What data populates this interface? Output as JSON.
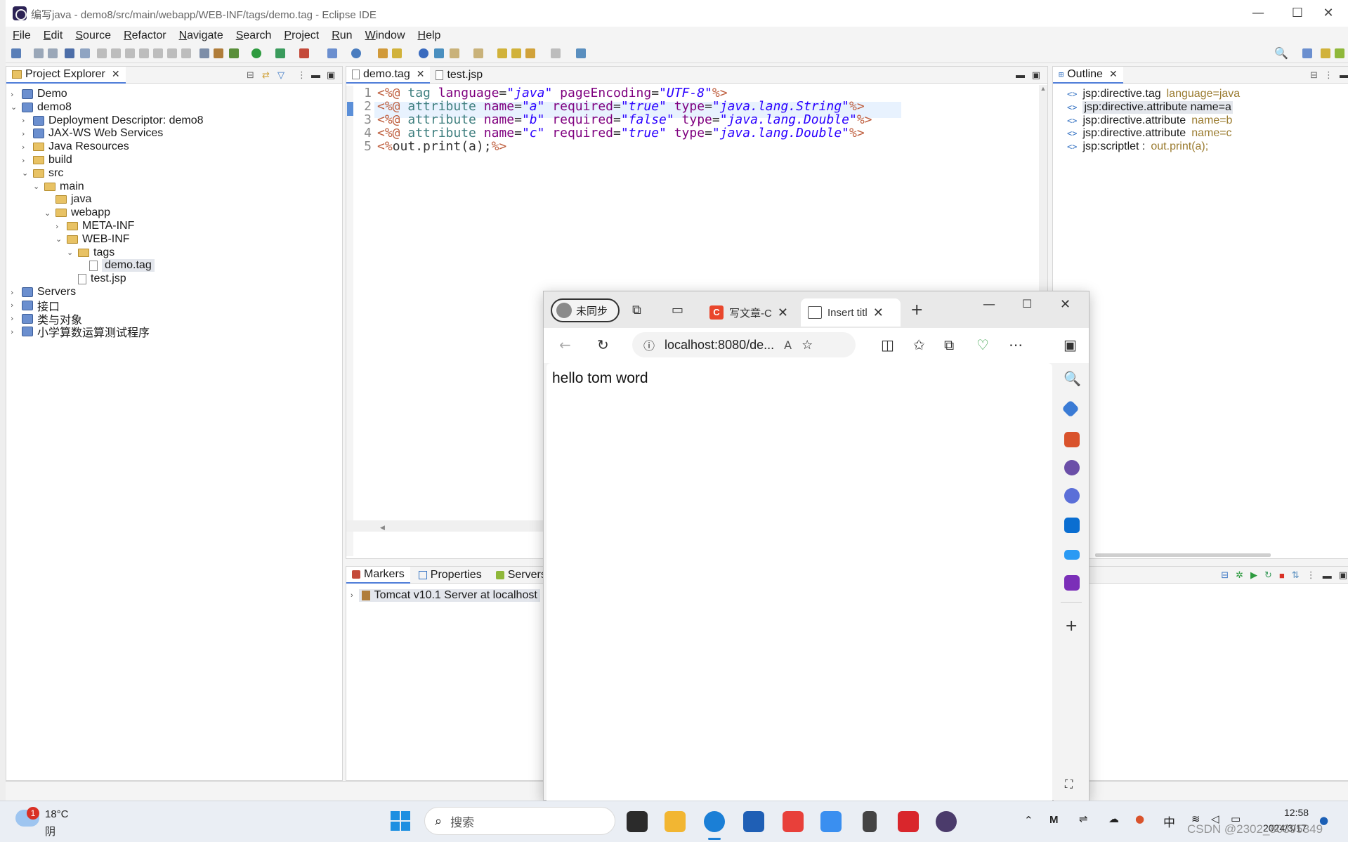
{
  "eclipse": {
    "title": "编写java - demo8/src/main/webapp/WEB-INF/tags/demo.tag - Eclipse IDE",
    "menu": [
      "File",
      "Edit",
      "Source",
      "Refactor",
      "Navigate",
      "Search",
      "Project",
      "Run",
      "Window",
      "Help"
    ],
    "explorer": {
      "tab": "Project Explorer",
      "tree": [
        {
          "label": "Demo",
          "depth": 0,
          "icon": "project-icon",
          "twisty": "›"
        },
        {
          "label": "demo8",
          "depth": 0,
          "icon": "project-icon",
          "twisty": "⌄"
        },
        {
          "label": "Deployment Descriptor: demo8",
          "depth": 1,
          "icon": "descriptor-icon",
          "twisty": "›"
        },
        {
          "label": "JAX-WS Web Services",
          "depth": 1,
          "icon": "webservice-icon",
          "twisty": "›"
        },
        {
          "label": "Java Resources",
          "depth": 1,
          "icon": "java-resources-icon",
          "twisty": "›"
        },
        {
          "label": "build",
          "depth": 1,
          "icon": "folder-icon",
          "twisty": "›"
        },
        {
          "label": "src",
          "depth": 1,
          "icon": "folder-icon",
          "twisty": "⌄"
        },
        {
          "label": "main",
          "depth": 2,
          "icon": "folder-icon",
          "twisty": "⌄"
        },
        {
          "label": "java",
          "depth": 3,
          "icon": "folder-icon",
          "twisty": ""
        },
        {
          "label": "webapp",
          "depth": 3,
          "icon": "folder-icon",
          "twisty": "⌄"
        },
        {
          "label": "META-INF",
          "depth": 4,
          "icon": "folder-icon",
          "twisty": "›"
        },
        {
          "label": "WEB-INF",
          "depth": 4,
          "icon": "folder-icon",
          "twisty": "⌄"
        },
        {
          "label": "tags",
          "depth": 5,
          "icon": "folder-icon",
          "twisty": "⌄"
        },
        {
          "label": "demo.tag",
          "depth": 6,
          "icon": "file-icon",
          "twisty": "",
          "selected": true
        },
        {
          "label": "test.jsp",
          "depth": 5,
          "icon": "file-icon",
          "twisty": ""
        },
        {
          "label": "Servers",
          "depth": 0,
          "icon": "project-icon",
          "twisty": "›"
        },
        {
          "label": "接口",
          "depth": 0,
          "icon": "project-icon",
          "twisty": "›"
        },
        {
          "label": "类与对象",
          "depth": 0,
          "icon": "project-icon",
          "twisty": "›"
        },
        {
          "label": "小学算数运算测试程序",
          "depth": 0,
          "icon": "project-icon",
          "twisty": "›"
        }
      ]
    },
    "editor": {
      "tabs": [
        "demo.tag",
        "test.jsp"
      ],
      "lines": [
        {
          "n": "1",
          "parts": [
            [
              "delim",
              "<%@ "
            ],
            [
              "kw",
              "tag "
            ],
            [
              "an",
              "language"
            ],
            [
              "plain",
              "="
            ],
            [
              "av",
              "\"java\""
            ],
            [
              "plain",
              " "
            ],
            [
              "an",
              "pageEncoding"
            ],
            [
              "plain",
              "="
            ],
            [
              "av",
              "\"UTF-8\""
            ],
            [
              "delim",
              "%>"
            ]
          ]
        },
        {
          "n": "2",
          "parts": [
            [
              "delim",
              "<%@ "
            ],
            [
              "kw",
              "attribute "
            ],
            [
              "an",
              "name"
            ],
            [
              "plain",
              "="
            ],
            [
              "av",
              "\"a\""
            ],
            [
              "plain",
              " "
            ],
            [
              "an",
              "required"
            ],
            [
              "plain",
              "="
            ],
            [
              "av",
              "\"true\""
            ],
            [
              "plain",
              " "
            ],
            [
              "an",
              "type"
            ],
            [
              "plain",
              "="
            ],
            [
              "av",
              "\"java.lang.String\""
            ],
            [
              "delim",
              "%>"
            ]
          ]
        },
        {
          "n": "3",
          "parts": [
            [
              "delim",
              "<%@ "
            ],
            [
              "kw",
              "attribute "
            ],
            [
              "an",
              "name"
            ],
            [
              "plain",
              "="
            ],
            [
              "av",
              "\"b\""
            ],
            [
              "plain",
              " "
            ],
            [
              "an",
              "required"
            ],
            [
              "plain",
              "="
            ],
            [
              "av",
              "\"false\""
            ],
            [
              "plain",
              " "
            ],
            [
              "an",
              "type"
            ],
            [
              "plain",
              "="
            ],
            [
              "av",
              "\"java.lang.Double\""
            ],
            [
              "delim",
              "%>"
            ]
          ]
        },
        {
          "n": "4",
          "parts": [
            [
              "delim",
              "<%@ "
            ],
            [
              "kw",
              "attribute "
            ],
            [
              "an",
              "name"
            ],
            [
              "plain",
              "="
            ],
            [
              "av",
              "\"c\""
            ],
            [
              "plain",
              " "
            ],
            [
              "an",
              "required"
            ],
            [
              "plain",
              "="
            ],
            [
              "av",
              "\"true\""
            ],
            [
              "plain",
              " "
            ],
            [
              "an",
              "type"
            ],
            [
              "plain",
              "="
            ],
            [
              "av",
              "\"java.lang.Double\""
            ],
            [
              "delim",
              "%>"
            ]
          ]
        },
        {
          "n": "5",
          "parts": [
            [
              "delim",
              "<%"
            ],
            [
              "plain",
              "out.print(a);"
            ],
            [
              "delim",
              "%>"
            ]
          ]
        }
      ]
    },
    "outline": {
      "tab": "Outline",
      "items": [
        {
          "label": "jsp:directive.tag",
          "extra": "language=java"
        },
        {
          "label": "jsp:directive.attribute name=a",
          "extra": "",
          "selected": true
        },
        {
          "label": "jsp:directive.attribute",
          "extra": "name=b"
        },
        {
          "label": "jsp:directive.attribute",
          "extra": "name=c"
        },
        {
          "label": "jsp:scriptlet :",
          "extra": "out.print(a);"
        }
      ]
    },
    "bottom": {
      "tabs": [
        "Markers",
        "Properties",
        "Servers"
      ],
      "server_row": "Tomcat v10.1 Server at localhost"
    }
  },
  "browser": {
    "profile": "未同步",
    "tabs": [
      {
        "label": "写文章-C",
        "icon": "csdn-icon"
      },
      {
        "label": "Insert titl",
        "icon": "page-icon",
        "active": true
      }
    ],
    "address": "localhost:8080/de...",
    "content_text": "hello tom word"
  },
  "taskbar": {
    "weather_temp": "18°C",
    "weather_desc": "阴",
    "weather_badge": "1",
    "search_placeholder": "搜索",
    "ime": "中",
    "time": "12:58",
    "date": "2024/3/17",
    "watermark": "CSDN @2302_80395349"
  },
  "colors": {
    "accent": "#4f7dd8",
    "selection": "#e3e6ec",
    "editor_current_line": "#e8f2fe"
  }
}
